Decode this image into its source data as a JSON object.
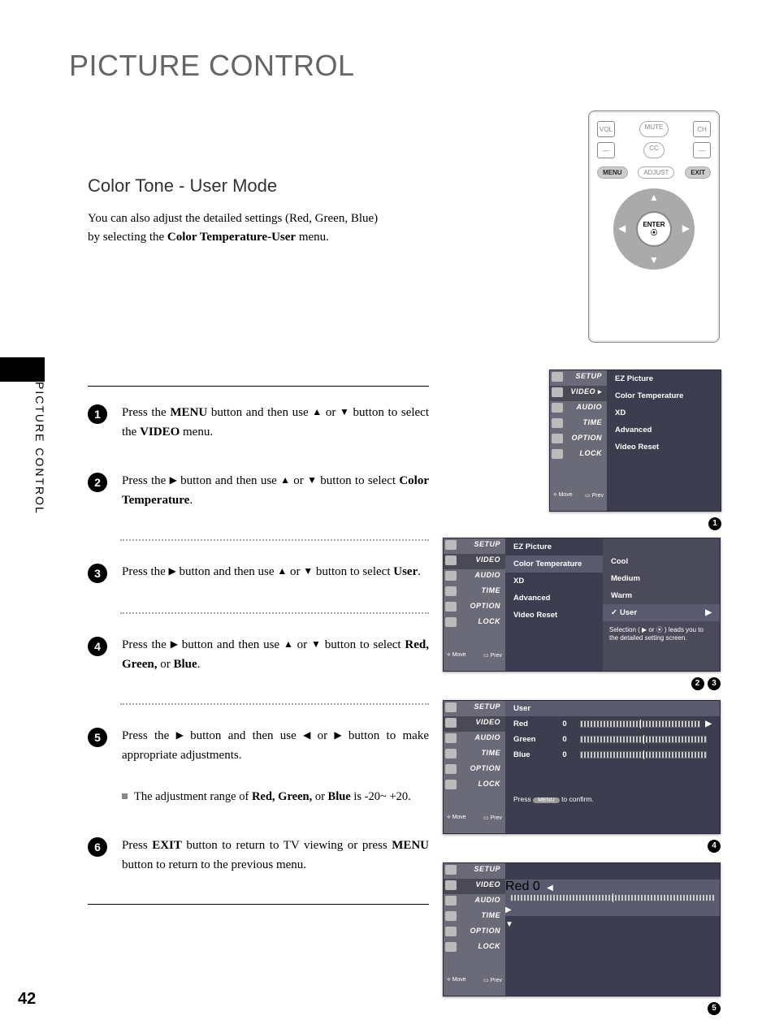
{
  "title_main": "PICTURE CONTROL",
  "subtitle": "Color Tone - User Mode",
  "intro_line1": "You can also adjust the detailed settings (Red, Green, Blue)",
  "intro_line2_a": "by selecting the ",
  "intro_line2_b": "Color Temperature-User",
  "intro_line2_c": " menu.",
  "side_text": "PICTURE CONTROL",
  "page_number": "42",
  "steps": {
    "s1": {
      "num": "1",
      "a": "Press the ",
      "menu": "MENU",
      "b": " button and then use ",
      "c": " or ",
      "d": " button to select the ",
      "video": "VIDEO",
      "e": " menu."
    },
    "s2": {
      "num": "2",
      "a": "Press the ",
      "b": " button and then use ",
      "c": " or ",
      "d": " button to select ",
      "item": "Color Temperature",
      "e": "."
    },
    "s3": {
      "num": "3",
      "a": "Press the ",
      "b": " button and then use ",
      "c": " or ",
      "d": " button to select ",
      "item": "User",
      "e": "."
    },
    "s4": {
      "num": "4",
      "a": "Press the ",
      "b": " button and then use ",
      "c": " or ",
      "d": " button to select ",
      "item": "Red, Green,",
      "or": " or ",
      "item2": "Blue",
      "e": "."
    },
    "s5": {
      "num": "5",
      "a": "Press the ",
      "b": " button and then use ",
      "c": " or ",
      "d": " button to make appropriate adjustments."
    },
    "s6": {
      "num": "6",
      "a": "Press ",
      "exit": "EXIT",
      "b": " button to return to TV viewing or press ",
      "menu": "MENU",
      "c": " button to return to the previous menu."
    }
  },
  "note_a": "The adjustment range of ",
  "note_b": "Red, Green,",
  "note_c": " or ",
  "note_d": "Blue",
  "note_e": " is  -20~ +20.",
  "remote": {
    "vol": "VOL",
    "mute": "MUTE",
    "ch": "CH",
    "minus1": "—",
    "cc": "CC",
    "minus2": "—",
    "menu": "MENU",
    "adjust": "ADJUST",
    "exit": "EXIT",
    "enter": "ENTER",
    "dot": "⦿"
  },
  "osd": {
    "tabs": {
      "setup": "SETUP",
      "video": "VIDEO",
      "audio": "AUDIO",
      "time": "TIME",
      "option": "OPTION",
      "lock": "LOCK"
    },
    "footer_move": "Move",
    "footer_prev": "Prev",
    "items": {
      "ez": "EZ Picture",
      "ct": "Color Temperature",
      "xd": "XD",
      "adv": "Advanced",
      "reset": "Video Reset"
    },
    "options": {
      "cool": "Cool",
      "medium": "Medium",
      "warm": "Warm",
      "user": "User"
    },
    "hint": "Selection ( ▶ or ⦿ ) leads you to the detailed setting screen.",
    "user_hdr": "User",
    "colors": {
      "red": "Red",
      "green": "Green",
      "blue": "Blue"
    },
    "zero": "0",
    "confirm_a": "Press ",
    "confirm_pill": "MENU",
    "confirm_b": " to confirm."
  },
  "badges": {
    "b1": "1",
    "b2": "2",
    "b3": "3",
    "b4": "4",
    "b5": "5"
  }
}
